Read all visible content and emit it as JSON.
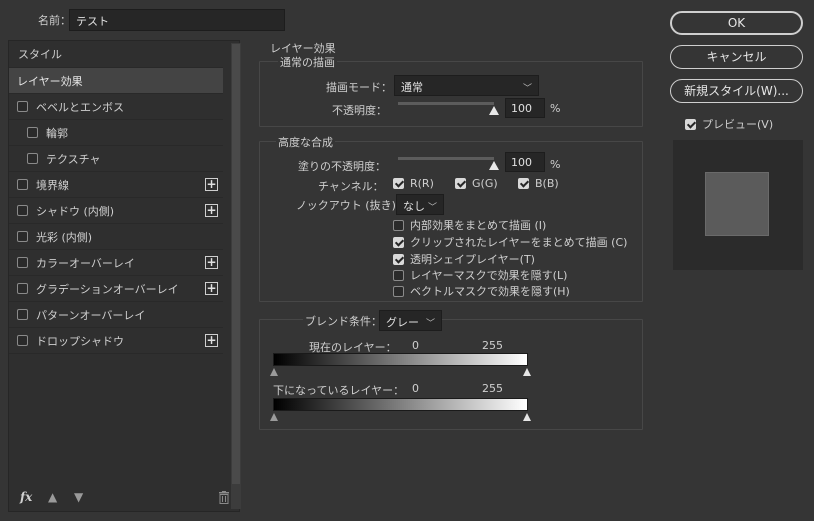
{
  "name_row": {
    "label": "名前：",
    "value": "テスト"
  },
  "style_list": {
    "header": "スタイル",
    "items": [
      {
        "label": "レイヤー効果",
        "selected": true,
        "checkbox": false,
        "indent": false,
        "plus": false
      },
      {
        "label": "ベベルとエンボス",
        "selected": false,
        "checkbox": true,
        "indent": false,
        "plus": false
      },
      {
        "label": "輪郭",
        "selected": false,
        "checkbox": true,
        "indent": true,
        "plus": false
      },
      {
        "label": "テクスチャ",
        "selected": false,
        "checkbox": true,
        "indent": true,
        "plus": false
      },
      {
        "label": "境界線",
        "selected": false,
        "checkbox": true,
        "indent": false,
        "plus": true
      },
      {
        "label": "シャドウ (内側)",
        "selected": false,
        "checkbox": true,
        "indent": false,
        "plus": true
      },
      {
        "label": "光彩 (内側)",
        "selected": false,
        "checkbox": true,
        "indent": false,
        "plus": false
      },
      {
        "label": "カラーオーバーレイ",
        "selected": false,
        "checkbox": true,
        "indent": false,
        "plus": true
      },
      {
        "label": "グラデーションオーバーレイ",
        "selected": false,
        "checkbox": true,
        "indent": false,
        "plus": true
      },
      {
        "label": "パターンオーバーレイ",
        "selected": false,
        "checkbox": true,
        "indent": false,
        "plus": false
      },
      {
        "label": "ドロップシャドウ",
        "selected": false,
        "checkbox": true,
        "indent": false,
        "plus": true
      }
    ],
    "bottom_icons": [
      "fx-icon",
      "move-up-icon",
      "move-down-icon",
      "trash-icon"
    ]
  },
  "layer_effects": {
    "title": "レイヤー効果",
    "normal_blend": {
      "title": "通常の描画",
      "mode_label": "描画モード：",
      "mode_value": "通常",
      "opacity_label": "不透明度：",
      "opacity_value": "100",
      "percent": "%"
    },
    "advanced_blend": {
      "title": "高度な合成",
      "fill_opacity_label": "塗りの不透明度：",
      "fill_opacity_value": "100",
      "percent": "%",
      "channels_label": "チャンネル：",
      "channels": [
        "R(R)",
        "G(G)",
        "B(B)"
      ],
      "knockout_label": "ノックアウト (抜き)：",
      "knockout_value": "なし",
      "options": [
        {
          "label": "内部効果をまとめて描画 (I)",
          "checked": false
        },
        {
          "label": "クリップされたレイヤーをまとめて描画 (C)",
          "checked": true
        },
        {
          "label": "透明シェイプレイヤー(T)",
          "checked": true
        },
        {
          "label": "レイヤーマスクで効果を隠す(L)",
          "checked": false
        },
        {
          "label": "ベクトルマスクで効果を隠す(H)",
          "checked": false
        }
      ]
    },
    "blend_if": {
      "label": "ブレンド条件：",
      "value": "グレー",
      "this_layer_label": "現在のレイヤー：",
      "underlying_label": "下になっているレイヤー：",
      "min": "0",
      "max": "255"
    }
  },
  "buttons": {
    "ok": "OK",
    "cancel": "キャンセル",
    "new_style": "新規スタイル(W)..."
  },
  "preview": {
    "label": "プレビュー(V)",
    "checked": true
  },
  "colors": {
    "background": "#353535",
    "panel": "#2f2f2f",
    "selected": "#444444"
  }
}
